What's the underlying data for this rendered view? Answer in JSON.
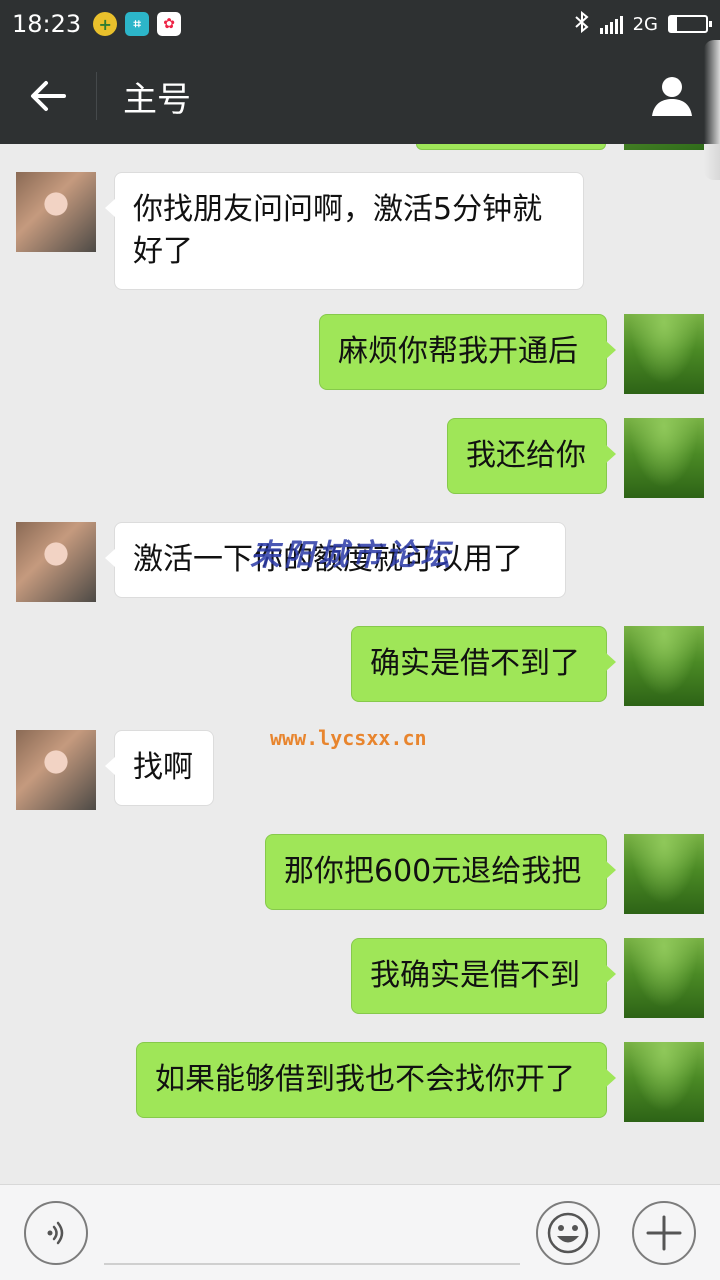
{
  "status_bar": {
    "time": "18:23",
    "network": "2G",
    "battery_level": 0.2,
    "icons": [
      "plus-circle-icon",
      "scan-icon",
      "app-icon",
      "bluetooth-icon",
      "signal-icon",
      "battery-icon"
    ]
  },
  "header": {
    "title": "主号",
    "back_icon": "arrow-left-icon",
    "profile_icon": "person-icon"
  },
  "messages": [
    {
      "side": "left",
      "text": "你找朋友问问啊，激活5分钟就好了"
    },
    {
      "side": "right",
      "text": "麻烦你帮我开通后"
    },
    {
      "side": "right",
      "text": "我还给你"
    },
    {
      "side": "left",
      "text": "激活一下你的额度就可以用了"
    },
    {
      "side": "right",
      "text": "确实是借不到了"
    },
    {
      "side": "left",
      "text": "找啊"
    },
    {
      "side": "right",
      "text": "那你把600元退给我把"
    },
    {
      "side": "right",
      "text": "我确实是借不到"
    },
    {
      "side": "right",
      "text": "如果能够借到我也不会找你开了"
    }
  ],
  "watermark": {
    "title": "耒阳城市论坛",
    "url": "www.lycsxx.cn"
  },
  "input_bar": {
    "value": "",
    "voice_icon": "voice-icon",
    "emoji_icon": "smiley-icon",
    "plus_icon": "plus-icon"
  },
  "colors": {
    "header_bg": "#2e3132",
    "chat_bg": "#ebebeb",
    "bubble_right": "#9fe658",
    "bubble_left": "#ffffff"
  }
}
